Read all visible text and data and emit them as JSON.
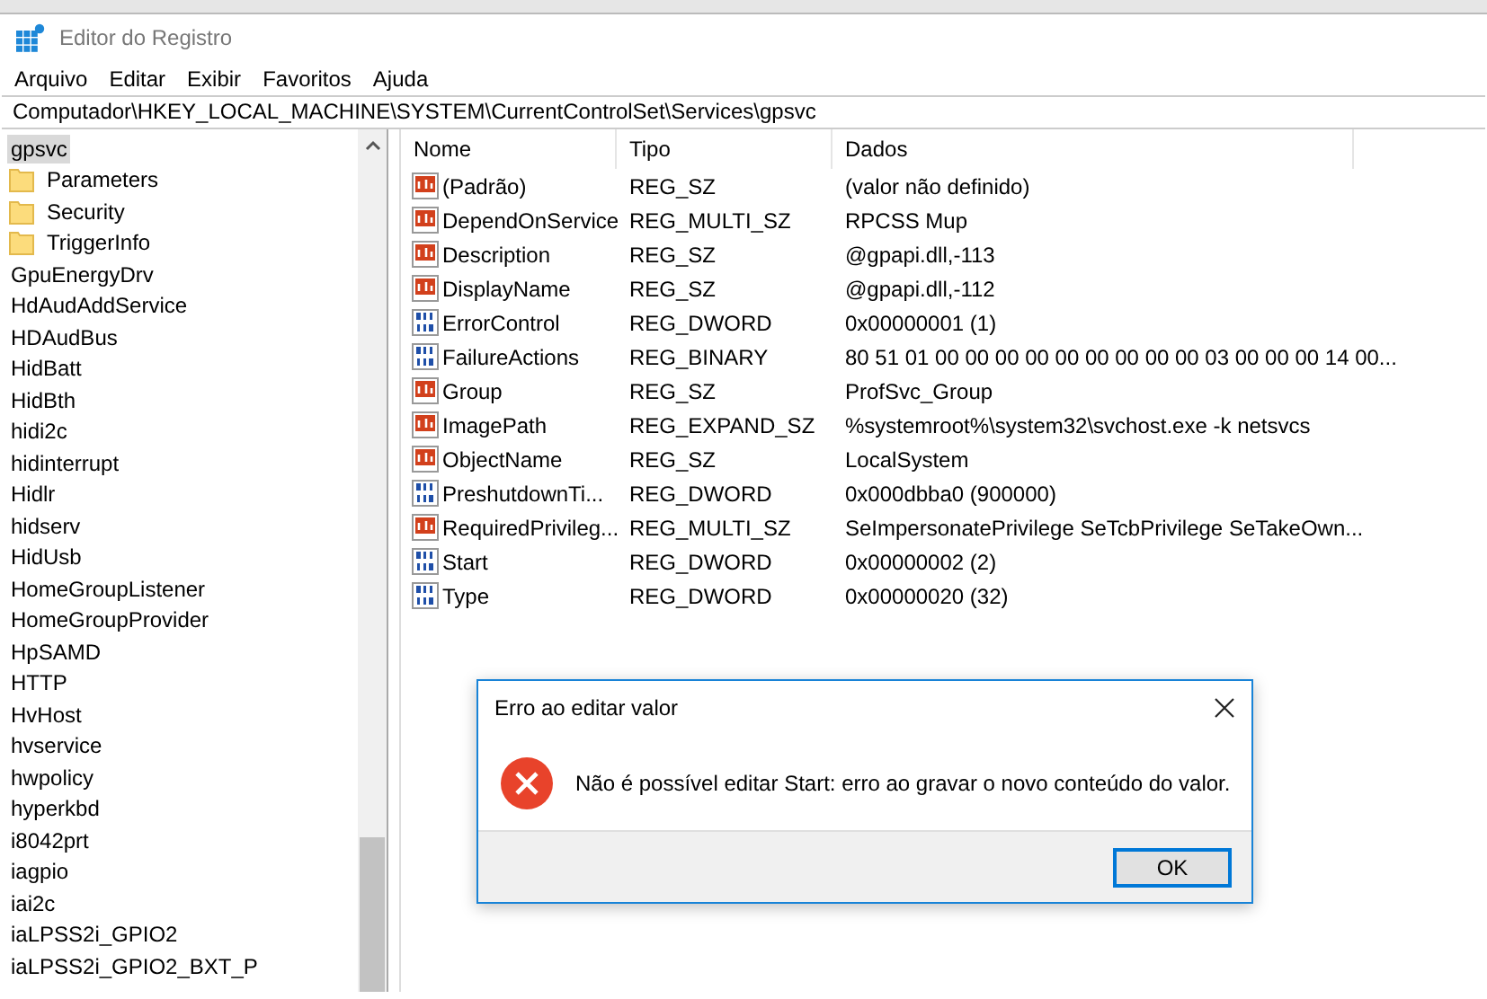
{
  "window": {
    "title": "Editor do Registro"
  },
  "menu": [
    "Arquivo",
    "Editar",
    "Exibir",
    "Favoritos",
    "Ajuda"
  ],
  "address": "Computador\\HKEY_LOCAL_MACHINE\\SYSTEM\\CurrentControlSet\\Services\\gpsvc",
  "tree": [
    {
      "label": "gpsvc",
      "selected": true,
      "children": [
        {
          "label": "Parameters",
          "selected": false
        },
        {
          "label": "Security",
          "selected": false
        },
        {
          "label": "TriggerInfo",
          "selected": false
        }
      ]
    },
    {
      "label": "GpuEnergyDrv",
      "selected": false
    },
    {
      "label": "HdAudAddService",
      "selected": false
    },
    {
      "label": "HDAudBus",
      "selected": false
    },
    {
      "label": "HidBatt",
      "selected": false
    },
    {
      "label": "HidBth",
      "selected": false
    },
    {
      "label": "hidi2c",
      "selected": false
    },
    {
      "label": "hidinterrupt",
      "selected": false
    },
    {
      "label": "Hidlr",
      "selected": false
    },
    {
      "label": "hidserv",
      "selected": false
    },
    {
      "label": "HidUsb",
      "selected": false
    },
    {
      "label": "HomeGroupListener",
      "selected": false
    },
    {
      "label": "HomeGroupProvider",
      "selected": false
    },
    {
      "label": "HpSAMD",
      "selected": false
    },
    {
      "label": "HTTP",
      "selected": false
    },
    {
      "label": "HvHost",
      "selected": false
    },
    {
      "label": "hvservice",
      "selected": false
    },
    {
      "label": "hwpolicy",
      "selected": false
    },
    {
      "label": "hyperkbd",
      "selected": false
    },
    {
      "label": "i8042prt",
      "selected": false
    },
    {
      "label": "iagpio",
      "selected": false
    },
    {
      "label": "iai2c",
      "selected": false
    },
    {
      "label": "iaLPSS2i_GPIO2",
      "selected": false
    },
    {
      "label": "iaLPSS2i_GPIO2_BXT_P",
      "selected": false
    }
  ],
  "table": {
    "columns": [
      "Nome",
      "Tipo",
      "Dados"
    ],
    "rows": [
      {
        "kind": "string",
        "name": "(Padrão)",
        "type": "REG_SZ",
        "data": "(valor não definido)"
      },
      {
        "kind": "string",
        "name": "DependOnService",
        "type": "REG_MULTI_SZ",
        "data": "RPCSS Mup"
      },
      {
        "kind": "string",
        "name": "Description",
        "type": "REG_SZ",
        "data": "@gpapi.dll,-113"
      },
      {
        "kind": "string",
        "name": "DisplayName",
        "type": "REG_SZ",
        "data": "@gpapi.dll,-112"
      },
      {
        "kind": "binary",
        "name": "ErrorControl",
        "type": "REG_DWORD",
        "data": "0x00000001 (1)"
      },
      {
        "kind": "binary",
        "name": "FailureActions",
        "type": "REG_BINARY",
        "data": "80 51 01 00 00 00 00 00 00 00 00 00 03 00 00 00 14 00..."
      },
      {
        "kind": "string",
        "name": "Group",
        "type": "REG_SZ",
        "data": "ProfSvc_Group"
      },
      {
        "kind": "string",
        "name": "ImagePath",
        "type": "REG_EXPAND_SZ",
        "data": "%systemroot%\\system32\\svchost.exe -k netsvcs"
      },
      {
        "kind": "string",
        "name": "ObjectName",
        "type": "REG_SZ",
        "data": "LocalSystem"
      },
      {
        "kind": "binary",
        "name": "PreshutdownTi...",
        "type": "REG_DWORD",
        "data": "0x000dbba0 (900000)"
      },
      {
        "kind": "string",
        "name": "RequiredPrivileg...",
        "type": "REG_MULTI_SZ",
        "data": "SeImpersonatePrivilege SeTcbPrivilege SeTakeOwn..."
      },
      {
        "kind": "binary",
        "name": "Start",
        "type": "REG_DWORD",
        "data": "0x00000002 (2)"
      },
      {
        "kind": "binary",
        "name": "Type",
        "type": "REG_DWORD",
        "data": "0x00000020 (32)"
      }
    ]
  },
  "dialog": {
    "title": "Erro ao editar valor",
    "message": "Não é possível editar Start: erro ao gravar o novo conteúdo do valor.",
    "buttons": [
      "OK"
    ]
  }
}
